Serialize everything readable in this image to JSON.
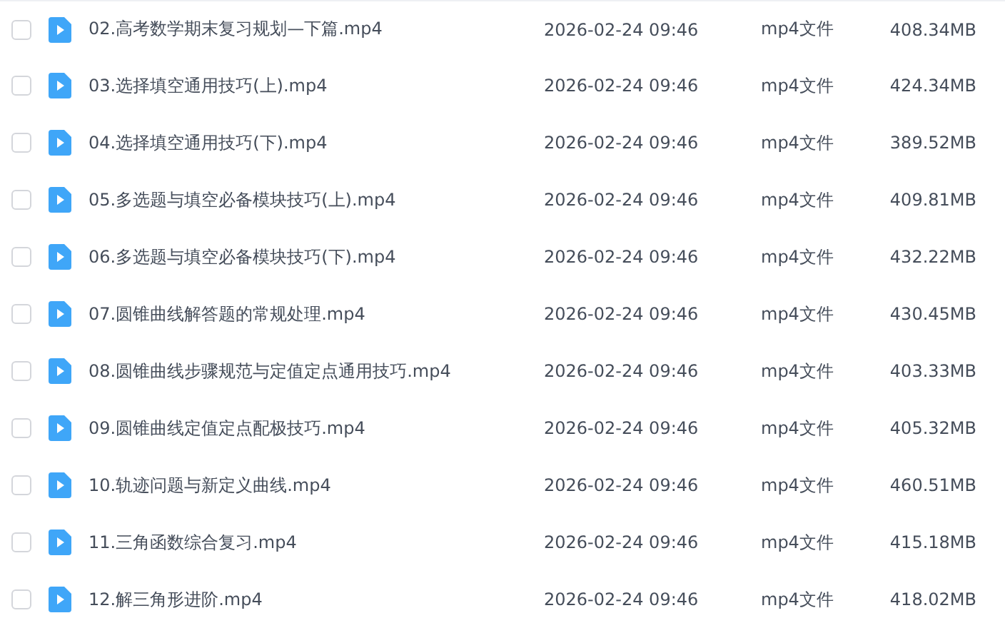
{
  "files": [
    {
      "name": "02.高考数学期末复习规划—下篇.mp4",
      "modified": "2026-02-24 09:46",
      "type": "mp4文件",
      "size": "408.34MB",
      "checked": false
    },
    {
      "name": "03.选择填空通用技巧(上).mp4",
      "modified": "2026-02-24 09:46",
      "type": "mp4文件",
      "size": "424.34MB",
      "checked": false
    },
    {
      "name": "04.选择填空通用技巧(下).mp4",
      "modified": "2026-02-24 09:46",
      "type": "mp4文件",
      "size": "389.52MB",
      "checked": false
    },
    {
      "name": "05.多选题与填空必备模块技巧(上).mp4",
      "modified": "2026-02-24 09:46",
      "type": "mp4文件",
      "size": "409.81MB",
      "checked": false
    },
    {
      "name": "06.多选题与填空必备模块技巧(下).mp4",
      "modified": "2026-02-24 09:46",
      "type": "mp4文件",
      "size": "432.22MB",
      "checked": false
    },
    {
      "name": "07.圆锥曲线解答题的常规处理.mp4",
      "modified": "2026-02-24 09:46",
      "type": "mp4文件",
      "size": "430.45MB",
      "checked": false
    },
    {
      "name": "08.圆锥曲线步骤规范与定值定点通用技巧.mp4",
      "modified": "2026-02-24 09:46",
      "type": "mp4文件",
      "size": "403.33MB",
      "checked": false
    },
    {
      "name": "09.圆锥曲线定值定点配极技巧.mp4",
      "modified": "2026-02-24 09:46",
      "type": "mp4文件",
      "size": "405.32MB",
      "checked": false
    },
    {
      "name": "10.轨迹问题与新定义曲线.mp4",
      "modified": "2026-02-24 09:46",
      "type": "mp4文件",
      "size": "460.51MB",
      "checked": false
    },
    {
      "name": "11.三角函数综合复习.mp4",
      "modified": "2026-02-24 09:46",
      "type": "mp4文件",
      "size": "415.18MB",
      "checked": false
    },
    {
      "name": "12.解三角形进阶.mp4",
      "modified": "2026-02-24 09:46",
      "type": "mp4文件",
      "size": "418.02MB",
      "checked": false
    }
  ]
}
